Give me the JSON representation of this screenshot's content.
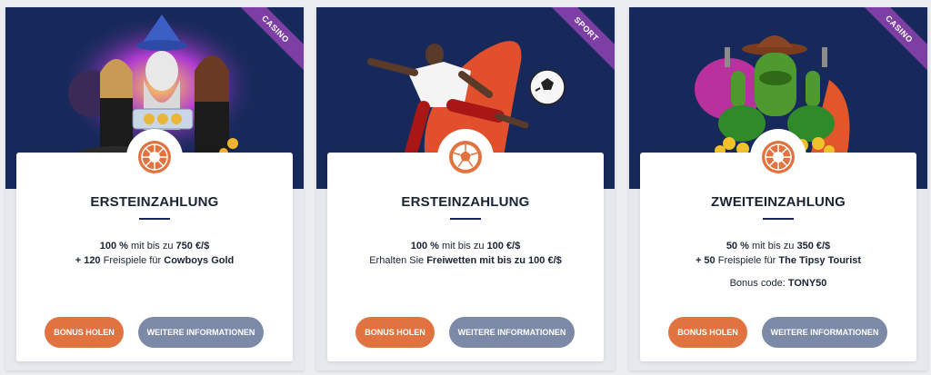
{
  "colors": {
    "hero_bg": "#17295a",
    "ribbon": "#7e3fa5",
    "primary_button": "#e0733f",
    "secondary_button": "#7d8aa7",
    "accent_orange": "#e0733f"
  },
  "cards": [
    {
      "ribbon": "CASINO",
      "icon": "roulette-icon",
      "title": "ERSTEINZAHLUNG",
      "line1_a": "100 %",
      "line1_b": " mit bis zu ",
      "line1_c": "750 €/$",
      "line2_a": "+ 120",
      "line2_b": " Freispiele für ",
      "line2_c": "Cowboys Gold",
      "bonus_code_label": "",
      "bonus_code": "",
      "primary_label": "BONUS HOLEN",
      "secondary_label": "WEITERE INFORMATIONEN"
    },
    {
      "ribbon": "SPORT",
      "icon": "soccer-ball-icon",
      "title": "ERSTEINZAHLUNG",
      "line1_a": "100 %",
      "line1_b": " mit bis zu ",
      "line1_c": "100 €/$",
      "line2_a": "",
      "line2_b": "Erhalten Sie ",
      "line2_c": "Freiwetten mit bis zu 100 €/$",
      "bonus_code_label": "",
      "bonus_code": "",
      "primary_label": "BONUS HOLEN",
      "secondary_label": "WEITERE INFORMATIONEN"
    },
    {
      "ribbon": "CASINO",
      "icon": "roulette-icon",
      "title": "ZWEITEINZAHLUNG",
      "line1_a": "50 %",
      "line1_b": " mit bis zu ",
      "line1_c": "350 €/$",
      "line2_a": "+ 50",
      "line2_b": " Freispiele für ",
      "line2_c": "The Tipsy Tourist",
      "bonus_code_label": "Bonus code: ",
      "bonus_code": "TONY50",
      "primary_label": "BONUS HOLEN",
      "secondary_label": "WEITERE INFORMATIONEN"
    }
  ]
}
